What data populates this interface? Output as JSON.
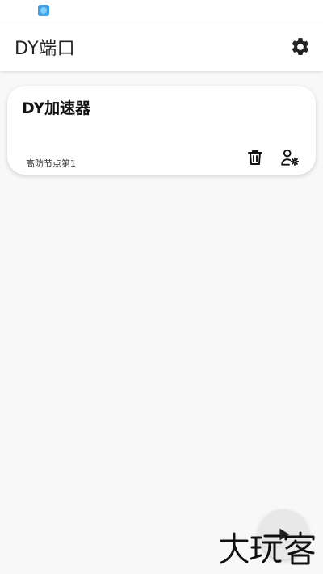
{
  "app": {
    "title": "DY端口"
  },
  "toolbar": {
    "settings_icon": "gear-icon"
  },
  "cards": [
    {
      "title": "DY加速器",
      "subtitle": "高防节点第1",
      "actions": [
        "trash-icon",
        "user-settings-icon"
      ]
    }
  ],
  "fab": {
    "icon": "play-icon"
  },
  "watermark": {
    "text": "大玩客"
  },
  "colors": {
    "background": "#f8f8f8",
    "card": "#ffffff",
    "fab": "#e8e8e8",
    "status_icon": "#3ea0e6"
  }
}
